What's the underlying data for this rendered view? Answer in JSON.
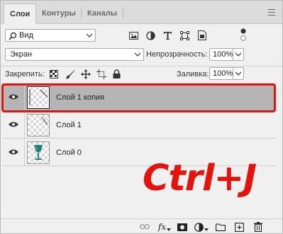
{
  "tabs": [
    {
      "label": "Слои",
      "active": true
    },
    {
      "label": "Контуры",
      "active": false
    },
    {
      "label": "Каналы",
      "active": false
    }
  ],
  "filter": {
    "kind_label": "Вид"
  },
  "blend": {
    "mode": "Экран",
    "opacity_label": "Непрозрачность:",
    "opacity_value": "100%"
  },
  "lock": {
    "label": "Закрепить:",
    "fill_label": "Заливка:",
    "fill_value": "100%"
  },
  "layers": [
    {
      "name": "Слой 1 копия",
      "selected": true
    },
    {
      "name": "Слой 1",
      "selected": false
    },
    {
      "name": "Слой 0",
      "selected": false
    }
  ],
  "annotation": {
    "text": "Ctrl+J",
    "color": "#e8120c"
  },
  "bottom_bar": {
    "fx_label": "fx"
  }
}
